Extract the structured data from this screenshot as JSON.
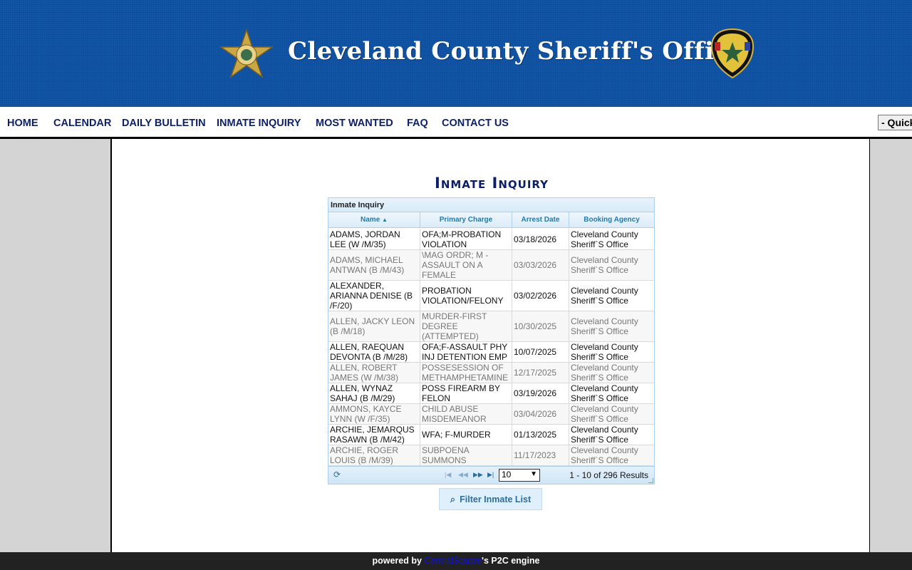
{
  "header": {
    "title": "Cleveland County Sheriff's Office",
    "star_logo": "sheriff-star-badge",
    "seal_logo": "cleveland-county-nc-seal"
  },
  "nav": {
    "items": [
      "HOME",
      "CALENDAR",
      "DAILY BULLETIN",
      "INMATE INQUIRY",
      "MOST WANTED",
      "FAQ",
      "CONTACT US"
    ],
    "quick_select": "- Quick"
  },
  "page": {
    "title": "Inmate Inquiry"
  },
  "grid": {
    "caption": "Inmate Inquiry",
    "columns": [
      "Name",
      "Primary Charge",
      "Arrest Date",
      "Booking Agency"
    ],
    "rows": [
      {
        "name": "ADAMS, JORDAN LEE (W /M/35)",
        "charge": "OFA;M-PROBATION VIOLATION",
        "date": "03/18/2026",
        "agency": "Cleveland County Sheriff`S Office"
      },
      {
        "name": "ADAMS, MICHAEL ANTWAN (B /M/43)",
        "charge": "\\MAG ORDR; M - ASSAULT ON A FEMALE",
        "date": "03/03/2026",
        "agency": "Cleveland County Sheriff`S Office"
      },
      {
        "name": "ALEXANDER, ARIANNA DENISE (B /F/20)",
        "charge": "PROBATION VIOLATION/FELONY",
        "date": "03/02/2026",
        "agency": "Cleveland County Sheriff`S Office"
      },
      {
        "name": "ALLEN, JACKY LEON (B /M/18)",
        "charge": "MURDER-FIRST DEGREE (ATTEMPTED)",
        "date": "10/30/2025",
        "agency": "Cleveland County Sheriff`S Office"
      },
      {
        "name": "ALLEN, RAEQUAN DEVONTA (B /M/28)",
        "charge": "OFA;F-ASSAULT PHY INJ DETENTION EMP",
        "date": "10/07/2025",
        "agency": "Cleveland County Sheriff`S Office"
      },
      {
        "name": "ALLEN, ROBERT JAMES (W /M/38)",
        "charge": "POSSESESSION OF METHAMPHETAMINE",
        "date": "12/17/2025",
        "agency": "Cleveland County Sheriff`S Office"
      },
      {
        "name": "ALLEN, WYNAZ SAHAJ (B /M/29)",
        "charge": "POSS FIREARM BY FELON",
        "date": "03/19/2026",
        "agency": "Cleveland County Sheriff`S Office"
      },
      {
        "name": "AMMONS, KAYCE LYNN (W /F/35)",
        "charge": "CHILD ABUSE MISDEMEANOR",
        "date": "03/04/2026",
        "agency": "Cleveland County Sheriff`S Office"
      },
      {
        "name": "ARCHIE, JEMARQUS RASAWN (B /M/42)",
        "charge": "WFA; F-MURDER",
        "date": "01/13/2025",
        "agency": "Cleveland County Sheriff`S Office"
      },
      {
        "name": "ARCHIE, ROGER LOUIS (B /M/39)",
        "charge": "SUBPOENA SUMMONS",
        "date": "11/17/2023",
        "agency": "Cleveland County Sheriff`S Office"
      }
    ],
    "page_size": "10",
    "results_text": "1 - 10 of 296 Results"
  },
  "filter_button": "Filter Inmate List",
  "footer": {
    "prefix": "powered by",
    "brand": "CentralSquare",
    "suffix": "'s P2C engine"
  },
  "colors": {
    "banner": "#0d4fa0",
    "nav_text": "#0b1f6b",
    "grid_header_text": "#2779aa"
  }
}
